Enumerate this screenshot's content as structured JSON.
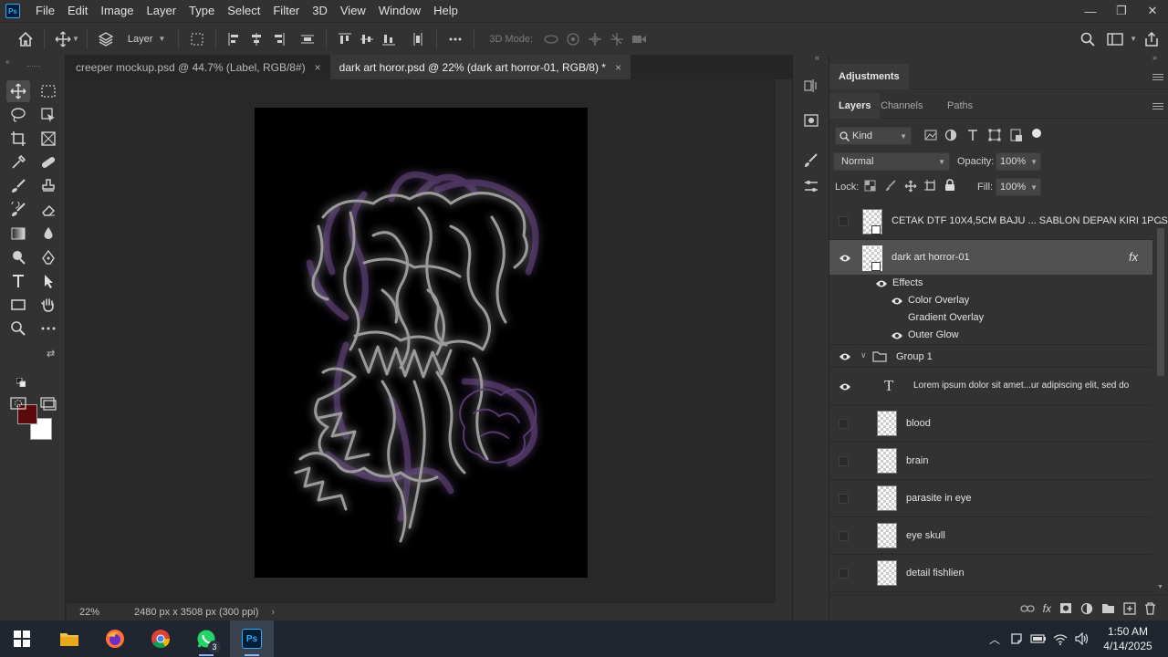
{
  "app": {
    "logo": "Ps"
  },
  "menu": [
    "File",
    "Edit",
    "Image",
    "Layer",
    "Type",
    "Select",
    "Filter",
    "3D",
    "View",
    "Window",
    "Help"
  ],
  "window_controls": {
    "minimize": "—",
    "restore": "❐",
    "close": "✕"
  },
  "options_bar": {
    "auto_select_target": "Layer",
    "mode3d_label": "3D Mode:"
  },
  "tabs": [
    {
      "label": "creeper mockup.psd @ 44.7% (Label, RGB/8#)",
      "close": "×"
    },
    {
      "label": "dark art horor.psd @ 22% (dark art horror-01, RGB/8) *",
      "close": "×"
    }
  ],
  "status": {
    "zoom": "22%",
    "doc_info": "2480 px x 3508 px (300 ppi)",
    "arrow": "›"
  },
  "colors": {
    "foreground": "#5a0a0a",
    "background": "#ffffff",
    "accent": "#31a8ff"
  },
  "panels": {
    "adjustments_title": "Adjustments",
    "tabs": [
      "Layers",
      "Channels",
      "Paths"
    ],
    "filter_kind": "Kind",
    "blend_mode": "Normal",
    "opacity_label": "Opacity:",
    "opacity_value": "100%",
    "lock_label": "Lock:",
    "fill_label": "Fill:",
    "fill_value": "100%"
  },
  "layers": [
    {
      "name": "CETAK DTF 10X4,5CM BAJU ... SABLON DEPAN KIRI 1PCS",
      "visible": false,
      "type": "smart"
    },
    {
      "name": "dark art horror-01",
      "visible": true,
      "type": "smart",
      "selected": true,
      "fx": "fx"
    },
    {
      "name": "Effects",
      "visible": true,
      "type": "effects"
    },
    {
      "name": "Color Overlay",
      "visible": true,
      "type": "effect"
    },
    {
      "name": "Gradient Overlay",
      "visible": false,
      "type": "effect"
    },
    {
      "name": "Outer Glow",
      "visible": true,
      "type": "effect"
    },
    {
      "name": "Group 1",
      "visible": true,
      "type": "group"
    },
    {
      "name": "Lorem ipsum dolor sit amet...ur adipiscing elit, sed do",
      "visible": true,
      "type": "text",
      "glyph": "T"
    },
    {
      "name": "blood",
      "visible": false,
      "type": "pixel"
    },
    {
      "name": "brain",
      "visible": false,
      "type": "pixel"
    },
    {
      "name": "parasite in eye",
      "visible": false,
      "type": "pixel"
    },
    {
      "name": "eye skull",
      "visible": false,
      "type": "pixel"
    },
    {
      "name": "detail fishlien",
      "visible": false,
      "type": "pixel"
    }
  ],
  "taskbar": {
    "apps": [
      "start-icon",
      "file-explorer-icon",
      "firefox-icon",
      "chrome-icon",
      "whatsapp-icon",
      "photoshop-icon"
    ],
    "whatsapp_badge": "3",
    "clock_time": "1:50 AM",
    "clock_date": "4/14/2025"
  }
}
